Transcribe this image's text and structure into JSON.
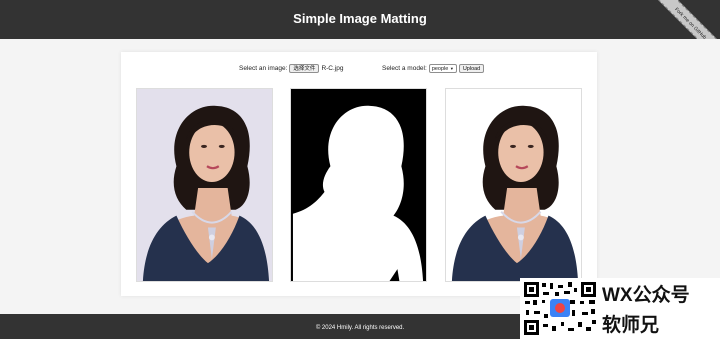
{
  "header": {
    "title": "Simple Image Matting",
    "ribbon_label": "Fork me on GitHub"
  },
  "controls": {
    "image_label": "Select an image:",
    "file_button": "选择文件",
    "file_name": "R-C.jpg",
    "model_label": "Select a model:",
    "model_selected": "people",
    "upload_button": "Upload"
  },
  "panels": {
    "original": "original-photo",
    "mask": "alpha-mask",
    "result": "matted-result"
  },
  "footer": {
    "text": "© 2024 Hmily. All rights reserved."
  },
  "watermark": {
    "line1": "WX公众号",
    "line2": "软师兄"
  },
  "colors": {
    "header_bg": "#333333",
    "page_bg": "#f4f4f4",
    "panel_border": "#dddddd"
  }
}
